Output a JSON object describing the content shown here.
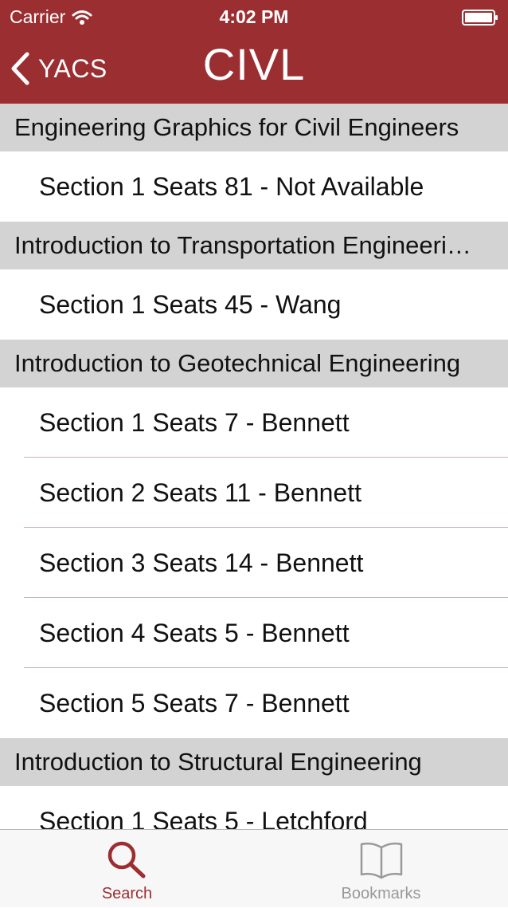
{
  "status_bar": {
    "carrier": "Carrier",
    "time": "4:02 PM"
  },
  "nav": {
    "back_label": "YACS",
    "title": "CIVL"
  },
  "list": {
    "groups": [
      {
        "title": "Engineering Graphics for Civil Engineers",
        "rows": [
          "Section 1 Seats 81 - Not Available"
        ]
      },
      {
        "title": "Introduction to Transportation Engineeri…",
        "rows": [
          "Section 1 Seats 45 - Wang"
        ]
      },
      {
        "title": "Introduction to Geotechnical Engineering",
        "rows": [
          "Section 1 Seats 7 - Bennett",
          "Section 2 Seats 11 - Bennett",
          "Section 3 Seats 14 - Bennett",
          "Section 4 Seats 5 - Bennett",
          "Section 5 Seats 7 - Bennett"
        ]
      },
      {
        "title": "Introduction to Structural Engineering",
        "rows": [
          "Section 1 Seats 5 - Letchford"
        ]
      }
    ]
  },
  "tabbar": {
    "search_label": "Search",
    "bookmarks_label": "Bookmarks",
    "active_color": "#9b2e31",
    "inactive_color": "#999999"
  },
  "colors": {
    "nav_background": "#9b2e31",
    "section_header": "#d3d3d3"
  }
}
